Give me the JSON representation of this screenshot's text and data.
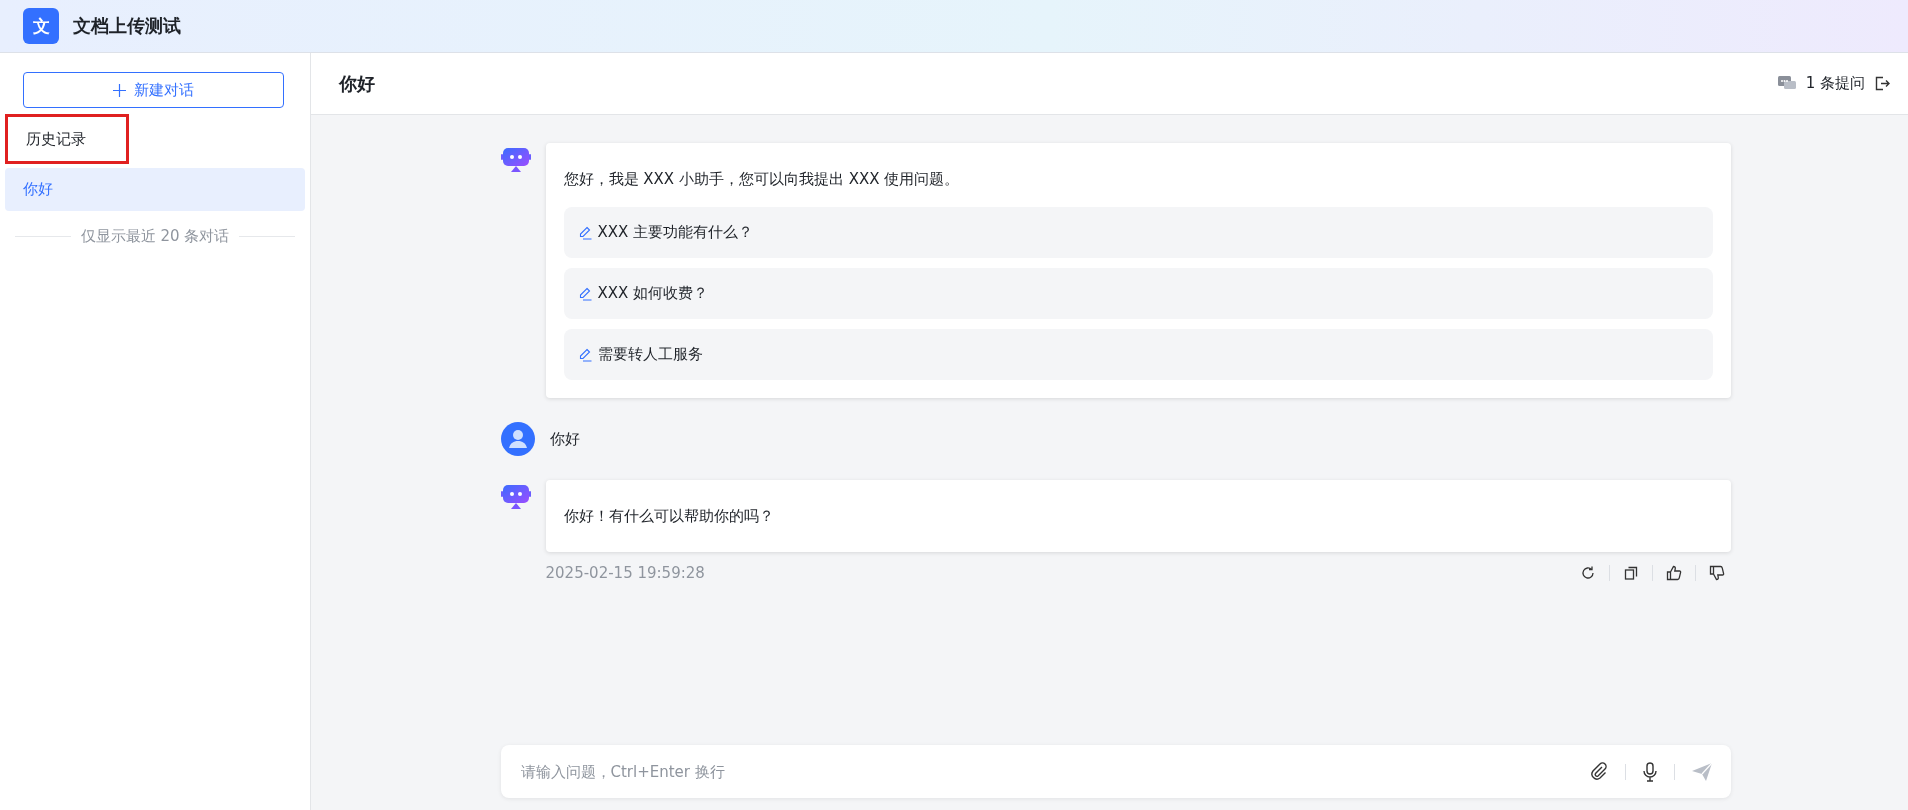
{
  "app": {
    "logo_char": "文",
    "title": "文档上传测试"
  },
  "sidebar": {
    "new_chat_button": "新建对话",
    "history_heading": {
      "label": "历史记录",
      "highlighted": true
    },
    "items": [
      {
        "label": "你好",
        "selected": true
      }
    ],
    "footer_note": "仅显示最近 20 条对话"
  },
  "chat_header": {
    "title": "你好",
    "question_count": "1 条提问"
  },
  "messages": [
    {
      "kind": "bot",
      "text": "您好，我是 XXX 小助手，您可以向我提出 XXX 使用问题。",
      "suggestions": [
        "XXX 主要功能有什么？",
        "XXX 如何收费？",
        "需要转人工服务"
      ]
    },
    {
      "kind": "user",
      "text": "你好"
    },
    {
      "kind": "bot",
      "text": "你好！有什么可以帮助你的吗？",
      "timestamp": "2025-02-15 19:59:28"
    }
  ],
  "input": {
    "placeholder": "请输入问题，Ctrl+Enter 换行"
  }
}
